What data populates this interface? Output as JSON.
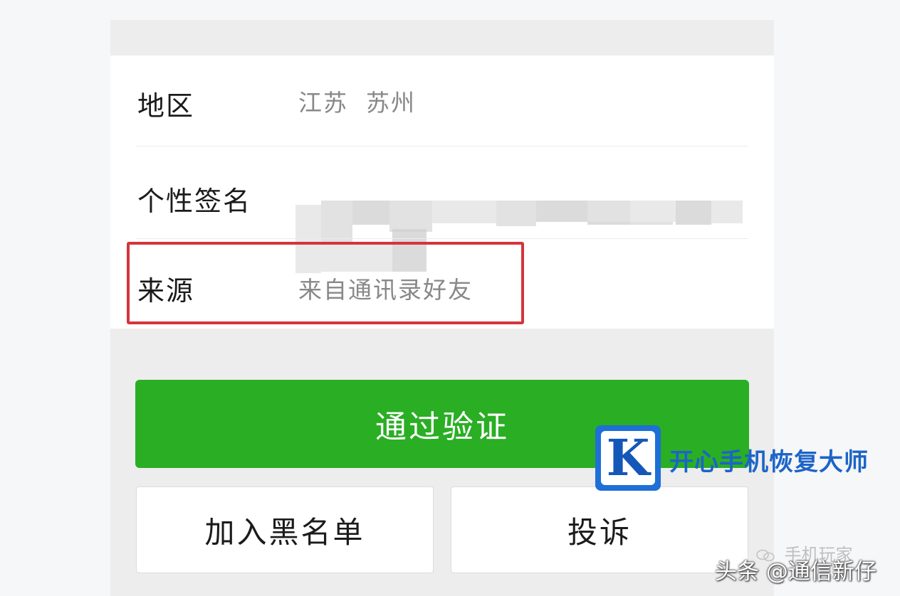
{
  "profile": {
    "region": {
      "label": "地区",
      "value": "江苏  苏州"
    },
    "signature": {
      "label": "个性签名"
    },
    "source": {
      "label": "来源",
      "value": "来自通讯录好友"
    }
  },
  "actions": {
    "verify_label": "通过验证",
    "blacklist_label": "加入黑名单",
    "report_label": "投诉"
  },
  "watermark": {
    "logo_letter": "K",
    "text": "开心手机恢复大师"
  },
  "credits": {
    "wechat": "手机玩家",
    "toutiao": "头条 @通信新仔"
  },
  "colors": {
    "accent_green": "#2aae24",
    "highlight_red": "#d5343d",
    "watermark_blue": "#1e6fd6"
  }
}
